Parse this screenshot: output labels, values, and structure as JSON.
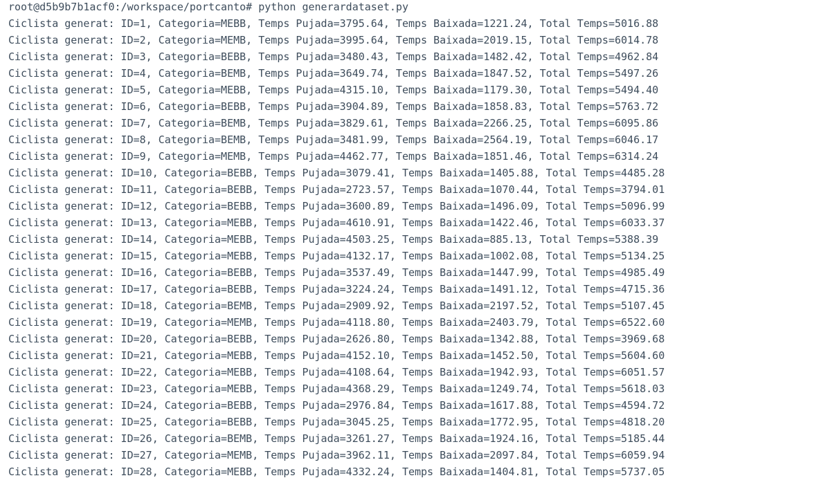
{
  "terminal": {
    "prompt": "root@d5b9b7b1acf0:/workspace/portcanto#",
    "command": "python generardataset.py",
    "lines": [
      "Ciclista generat: ID=1, Categoria=MEBB, Temps Pujada=3795.64, Temps Baixada=1221.24, Total Temps=5016.88",
      "Ciclista generat: ID=2, Categoria=MEMB, Temps Pujada=3995.64, Temps Baixada=2019.15, Total Temps=6014.78",
      "Ciclista generat: ID=3, Categoria=BEBB, Temps Pujada=3480.43, Temps Baixada=1482.42, Total Temps=4962.84",
      "Ciclista generat: ID=4, Categoria=BEMB, Temps Pujada=3649.74, Temps Baixada=1847.52, Total Temps=5497.26",
      "Ciclista generat: ID=5, Categoria=MEBB, Temps Pujada=4315.10, Temps Baixada=1179.30, Total Temps=5494.40",
      "Ciclista generat: ID=6, Categoria=BEBB, Temps Pujada=3904.89, Temps Baixada=1858.83, Total Temps=5763.72",
      "Ciclista generat: ID=7, Categoria=BEMB, Temps Pujada=3829.61, Temps Baixada=2266.25, Total Temps=6095.86",
      "Ciclista generat: ID=8, Categoria=BEMB, Temps Pujada=3481.99, Temps Baixada=2564.19, Total Temps=6046.17",
      "Ciclista generat: ID=9, Categoria=MEMB, Temps Pujada=4462.77, Temps Baixada=1851.46, Total Temps=6314.24",
      "Ciclista generat: ID=10, Categoria=BEBB, Temps Pujada=3079.41, Temps Baixada=1405.88, Total Temps=4485.28",
      "Ciclista generat: ID=11, Categoria=BEBB, Temps Pujada=2723.57, Temps Baixada=1070.44, Total Temps=3794.01",
      "Ciclista generat: ID=12, Categoria=BEBB, Temps Pujada=3600.89, Temps Baixada=1496.09, Total Temps=5096.99",
      "Ciclista generat: ID=13, Categoria=MEBB, Temps Pujada=4610.91, Temps Baixada=1422.46, Total Temps=6033.37",
      "Ciclista generat: ID=14, Categoria=MEBB, Temps Pujada=4503.25, Temps Baixada=885.13, Total Temps=5388.39",
      "Ciclista generat: ID=15, Categoria=MEBB, Temps Pujada=4132.17, Temps Baixada=1002.08, Total Temps=5134.25",
      "Ciclista generat: ID=16, Categoria=BEBB, Temps Pujada=3537.49, Temps Baixada=1447.99, Total Temps=4985.49",
      "Ciclista generat: ID=17, Categoria=BEBB, Temps Pujada=3224.24, Temps Baixada=1491.12, Total Temps=4715.36",
      "Ciclista generat: ID=18, Categoria=BEMB, Temps Pujada=2909.92, Temps Baixada=2197.52, Total Temps=5107.45",
      "Ciclista generat: ID=19, Categoria=MEMB, Temps Pujada=4118.80, Temps Baixada=2403.79, Total Temps=6522.60",
      "Ciclista generat: ID=20, Categoria=BEBB, Temps Pujada=2626.80, Temps Baixada=1342.88, Total Temps=3969.68",
      "Ciclista generat: ID=21, Categoria=MEBB, Temps Pujada=4152.10, Temps Baixada=1452.50, Total Temps=5604.60",
      "Ciclista generat: ID=22, Categoria=MEBB, Temps Pujada=4108.64, Temps Baixada=1942.93, Total Temps=6051.57",
      "Ciclista generat: ID=23, Categoria=MEBB, Temps Pujada=4368.29, Temps Baixada=1249.74, Total Temps=5618.03",
      "Ciclista generat: ID=24, Categoria=BEBB, Temps Pujada=2976.84, Temps Baixada=1617.88, Total Temps=4594.72",
      "Ciclista generat: ID=25, Categoria=BEBB, Temps Pujada=3045.25, Temps Baixada=1772.95, Total Temps=4818.20",
      "Ciclista generat: ID=26, Categoria=BEMB, Temps Pujada=3261.27, Temps Baixada=1924.16, Total Temps=5185.44",
      "Ciclista generat: ID=27, Categoria=MEMB, Temps Pujada=3962.11, Temps Baixada=2097.84, Total Temps=6059.94",
      "Ciclista generat: ID=28, Categoria=MEBB, Temps Pujada=4332.24, Temps Baixada=1404.81, Total Temps=5737.05"
    ]
  }
}
